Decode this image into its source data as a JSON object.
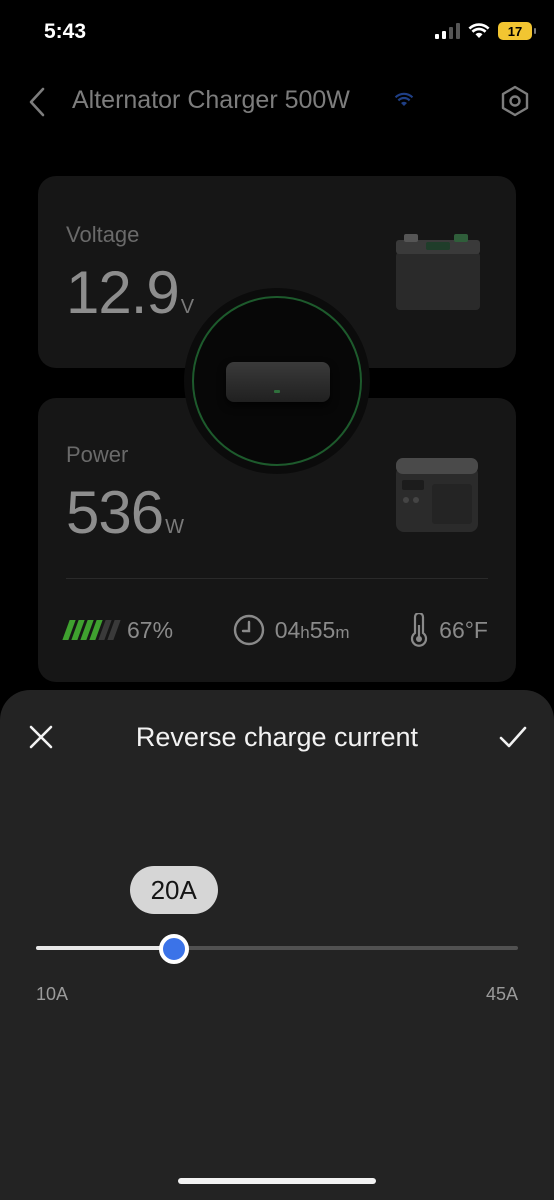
{
  "status_bar": {
    "time": "5:43",
    "battery": "17"
  },
  "header": {
    "title": "Alternator Charger 500W"
  },
  "voltage_card": {
    "label": "Voltage",
    "value": "12.9",
    "unit": "V"
  },
  "power_card": {
    "label": "Power",
    "value": "536",
    "unit": "W"
  },
  "stats": {
    "battery_percent": "67%",
    "battery_level": 0.67,
    "time_hours": "04",
    "time_h_unit": "h",
    "time_minutes": "55",
    "time_m_unit": "m",
    "temperature": "66°F"
  },
  "sheet": {
    "title": "Reverse charge current",
    "slider": {
      "min": 10,
      "max": 45,
      "value": 20,
      "value_label": "20A",
      "min_label": "10A",
      "max_label": "45A"
    }
  },
  "colors": {
    "accent": "#3b73e8",
    "ring": "#1d5a2c",
    "battery_green": "#3fa12f",
    "battery_yellow": "#f2c531"
  },
  "icons": {
    "back": "chevron-left-icon",
    "settings": "hexagon-gear-icon",
    "wifi": "wifi-icon",
    "close": "close-icon",
    "confirm": "checkmark-icon",
    "clock": "clock-icon",
    "thermometer": "thermometer-icon"
  }
}
